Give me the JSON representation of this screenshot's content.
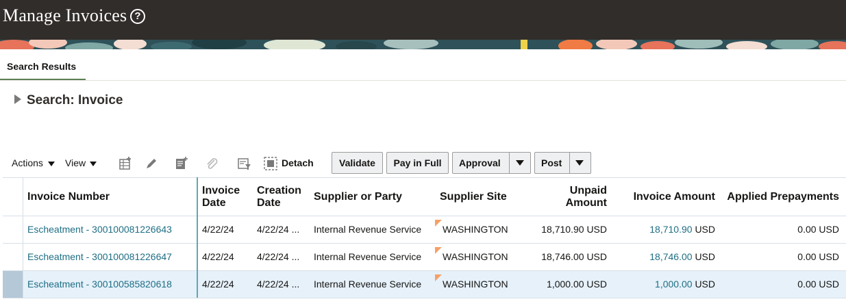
{
  "header": {
    "title": "Manage Invoices",
    "help_glyph": "?",
    "colors": {
      "bar": "#312d2a",
      "accent": "#5c7e51",
      "link": "#1e6e84"
    }
  },
  "tabs": [
    {
      "label": "Search Results",
      "active": true
    }
  ],
  "search": {
    "title": "Search: Invoice",
    "expanded": false,
    "toggle_icon": "disclosure-triangle-right-icon"
  },
  "toolbar": {
    "actions_label": "Actions",
    "view_label": "View",
    "icons": [
      "create-invoice-icon",
      "edit-pencil-icon",
      "validate-doc-icon",
      "attachment-paperclip-icon",
      "filter-doc-icon",
      "detach-icon"
    ],
    "detach_label": "Detach",
    "validate_label": "Validate",
    "pay_in_full_label": "Pay in Full",
    "approval_label": "Approval",
    "post_label": "Post"
  },
  "table": {
    "columns": {
      "invoice_number": "Invoice Number",
      "invoice_date_1": "Invoice",
      "invoice_date_2": "Date",
      "creation_date_1": "Creation",
      "creation_date_2": "Date",
      "supplier": "Supplier or Party",
      "site": "Supplier Site",
      "unpaid_1": "Unpaid",
      "unpaid_2": "Amount",
      "invoice_amount": "Invoice Amount",
      "applied_prepayments": "Applied Prepayments"
    },
    "rows": [
      {
        "invoice_number": "Escheatment - 300100081226643",
        "invoice_date": "4/22/24",
        "creation_date": "4/22/24 ...",
        "supplier": "Internal Revenue Service",
        "site": "WASHINGTON",
        "unpaid": "18,710.90 USD",
        "invoice_amount": "18,710.90",
        "invoice_currency": "USD",
        "applied_prepayments": "0.00 USD",
        "selected": false
      },
      {
        "invoice_number": "Escheatment - 300100081226647",
        "invoice_date": "4/22/24",
        "creation_date": "4/22/24 ...",
        "supplier": "Internal Revenue Service",
        "site": "WASHINGTON",
        "unpaid": "18,746.00 USD",
        "invoice_amount": "18,746.00",
        "invoice_currency": "USD",
        "applied_prepayments": "0.00 USD",
        "selected": false
      },
      {
        "invoice_number": "Escheatment - 300100585820618",
        "invoice_date": "4/22/24",
        "creation_date": "4/22/24 ...",
        "supplier": "Internal Revenue Service",
        "site": "WASHINGTON",
        "unpaid": "1,000.00 USD",
        "invoice_amount": "1,000.00",
        "invoice_currency": "USD",
        "applied_prepayments": "0.00 USD",
        "selected": true
      }
    ]
  }
}
